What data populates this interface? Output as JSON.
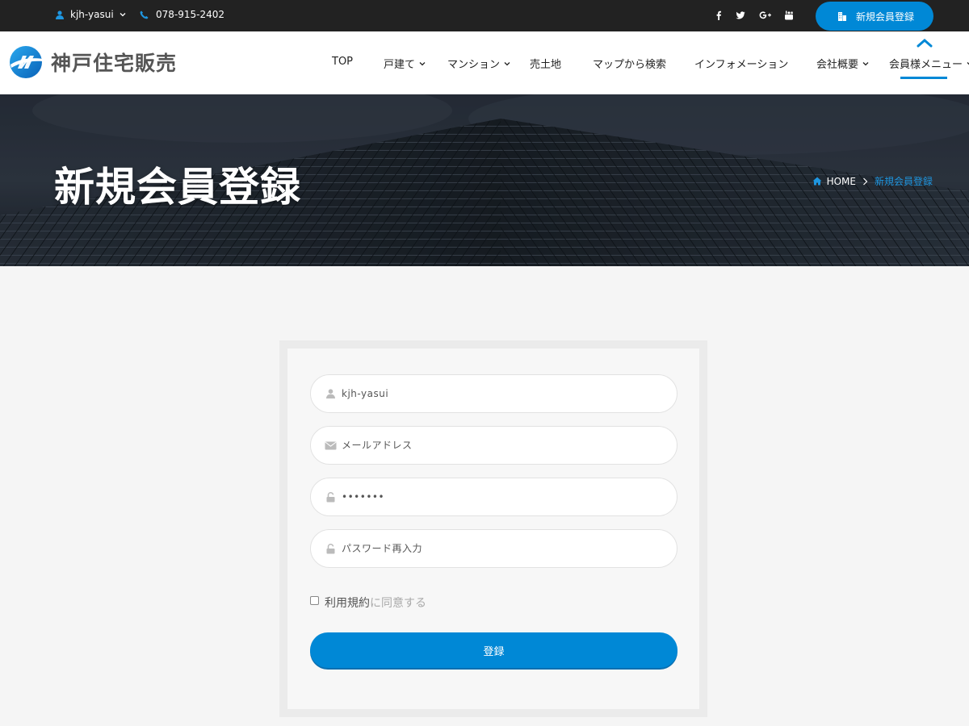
{
  "colors": {
    "primary": "#0088d6",
    "topbar_bg": "#222222",
    "breadcrumb_current": "#1e96e0",
    "page_bg": "#f5f5f5"
  },
  "topbar": {
    "username": "kjh-yasui",
    "phone": "078-915-2402",
    "social_icons": [
      "facebook-icon",
      "twitter-icon",
      "google-plus-icon",
      "youtube-icon"
    ],
    "register_button": "新規会員登録"
  },
  "navbar": {
    "logo_text": "神戸住宅販売",
    "items": [
      {
        "label": "TOP",
        "has_dropdown": false
      },
      {
        "label": "戸建て",
        "has_dropdown": true
      },
      {
        "label": "マンション",
        "has_dropdown": true
      },
      {
        "label": "売土地",
        "has_dropdown": false
      },
      {
        "label": "マップから検索",
        "has_dropdown": false
      },
      {
        "label": "インフォメーション",
        "has_dropdown": false
      },
      {
        "label": "会社概要",
        "has_dropdown": true
      },
      {
        "label": "会員様メニュー",
        "has_dropdown": true,
        "active": true
      }
    ]
  },
  "banner": {
    "title": "新規会員登録",
    "breadcrumb": {
      "home": "HOME",
      "current": "新規会員登録"
    }
  },
  "form": {
    "username": {
      "value": "kjh-yasui",
      "placeholder": ""
    },
    "email": {
      "value": "",
      "placeholder": "メールアドレス"
    },
    "password": {
      "value": "•••••••",
      "placeholder": ""
    },
    "password_confirm": {
      "value": "",
      "placeholder": "パスワード再入力"
    },
    "terms": {
      "link_text": "利用規約",
      "rest_text": "に同意する",
      "checked": false
    },
    "submit_label": "登録"
  }
}
